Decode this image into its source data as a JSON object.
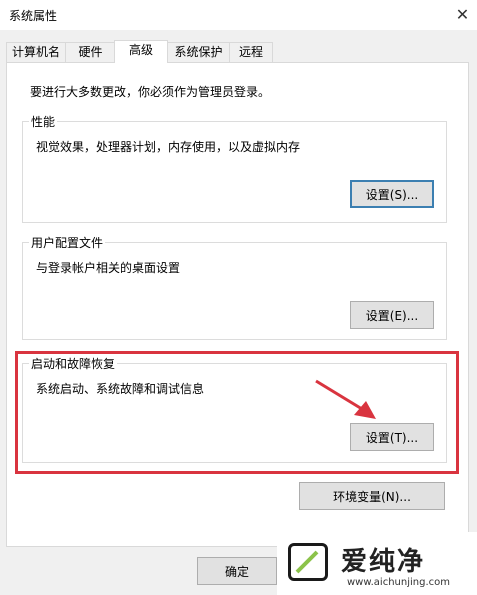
{
  "window": {
    "title": "系统属性",
    "close_glyph": "✕"
  },
  "tabs": [
    {
      "label": "计算机名"
    },
    {
      "label": "硬件"
    },
    {
      "label": "高级"
    },
    {
      "label": "系统保护"
    },
    {
      "label": "远程"
    }
  ],
  "advanced": {
    "admin_note": "要进行大多数更改，你必须作为管理员登录。",
    "performance": {
      "title": "性能",
      "desc": "视觉效果，处理器计划，内存使用，以及虚拟内存",
      "button": "设置(S)..."
    },
    "user_profiles": {
      "title": "用户配置文件",
      "desc": "与登录帐户相关的桌面设置",
      "button": "设置(E)..."
    },
    "startup_recovery": {
      "title": "启动和故障恢复",
      "desc": "系统启动、系统故障和调试信息",
      "button": "设置(T)..."
    },
    "env_button": "环境变量(N)..."
  },
  "footer": {
    "ok_button": "确定"
  },
  "annotation": {
    "highlight_color": "#d9343f",
    "arrow_color": "#d9343f"
  },
  "watermark": {
    "text": "爱纯净",
    "url": "www.aichunjing.com"
  }
}
